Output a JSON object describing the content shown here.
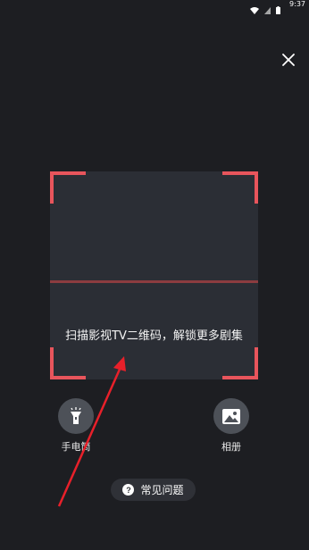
{
  "status_bar": {
    "time": "9:37",
    "icons": [
      "wifi-icon",
      "signal-icon",
      "battery-icon"
    ]
  },
  "header": {
    "close_icon": "close-icon"
  },
  "scanner": {
    "hint": "扫描影视TV二维码，解锁更多剧集",
    "frame_color": "#e8555c"
  },
  "controls": {
    "flashlight_label": "手电筒",
    "album_label": "相册"
  },
  "faq": {
    "label": "常见问题",
    "icon_glyph": "?"
  },
  "annotation": {
    "arrow_color": "#e8202a"
  }
}
